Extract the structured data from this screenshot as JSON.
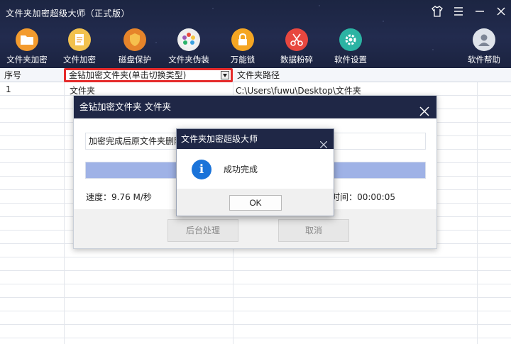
{
  "app": {
    "title": "文件夹加密超级大师（正式版）"
  },
  "window_controls": [
    "shirt-icon",
    "menu-icon",
    "minimize-icon",
    "close-icon"
  ],
  "toolbar": [
    {
      "icon": "folder-lock-icon",
      "label": "文件夹加密",
      "color": "#f39b2e"
    },
    {
      "icon": "file-lock-icon",
      "label": "文件加密",
      "color": "#f2c14e"
    },
    {
      "icon": "shield-icon",
      "label": "磁盘保护",
      "color": "#f0a33a"
    },
    {
      "icon": "palette-icon",
      "label": "文件夹伪装",
      "color": "#eeeeee"
    },
    {
      "icon": "padlock-icon",
      "label": "万能锁",
      "color": "#f5a623"
    },
    {
      "icon": "scissors-icon",
      "label": "数据粉碎",
      "color": "#e8473f"
    },
    {
      "icon": "gear-icon",
      "label": "软件设置",
      "color": "#2bb3a3"
    },
    {
      "icon": "user-icon",
      "label": "软件帮助",
      "color": "#dfe3ea"
    }
  ],
  "grid": {
    "headers": {
      "index": "序号",
      "type_selector": "金钻加密文件夹(单击切换类型)",
      "path": "文件夹路径"
    },
    "rows": [
      {
        "index": "1",
        "name": "文件夹",
        "path": "C:\\Users\\fuwu\\Desktop\\文件夹"
      }
    ]
  },
  "progress_dialog": {
    "title": "金钻加密文件夹 文件夹",
    "message": "加密完成后原文件夹删除",
    "progress": 1.0,
    "speed": "速度：9.76 M/秒",
    "time_visible": "用时间：00:00:05",
    "buttons": {
      "background": "后台处理",
      "cancel": "取消"
    }
  },
  "message_box": {
    "title": "文件夹加密超级大师",
    "text": "成功完成",
    "ok": "OK"
  },
  "colors": {
    "banner": "#1f2746",
    "highlight_border": "#e52b2b",
    "progress_fill": "#9fb2e6",
    "info_blue": "#1a73d9"
  }
}
